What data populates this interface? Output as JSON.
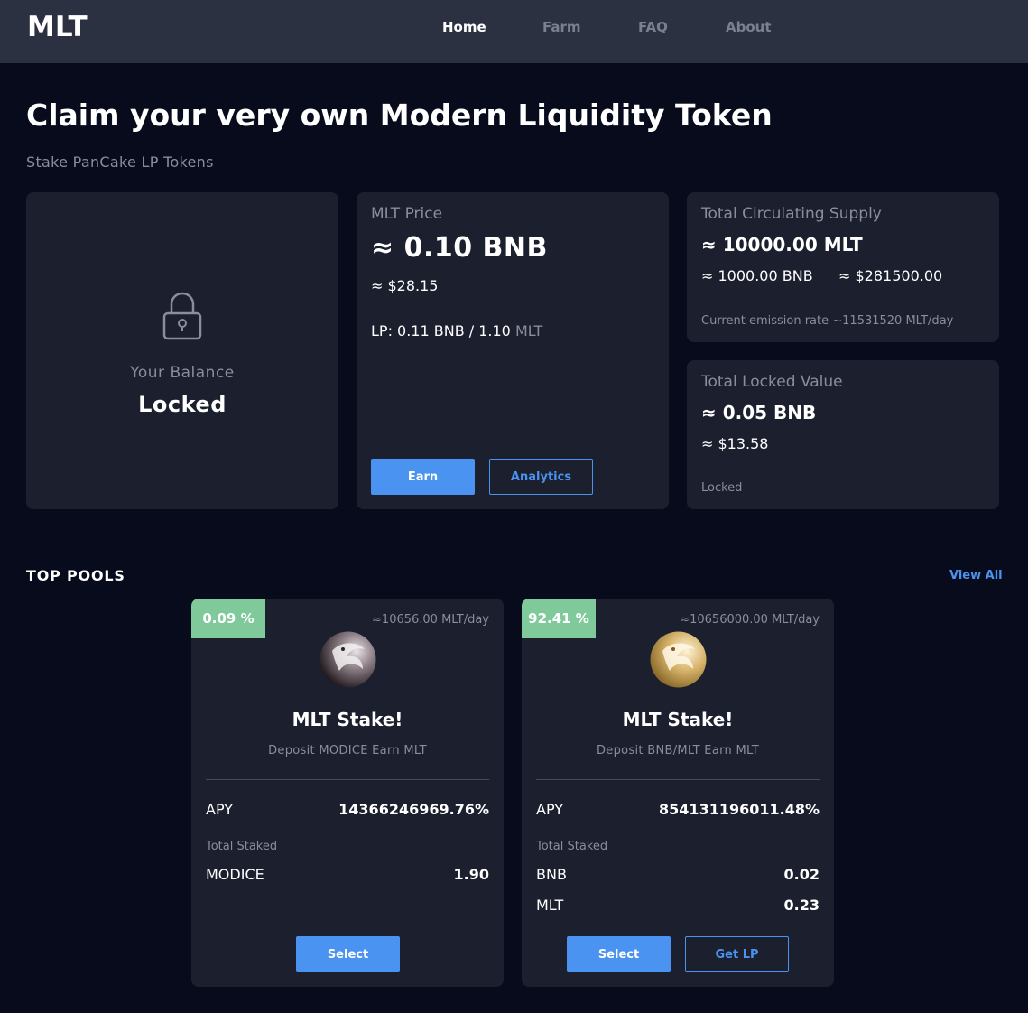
{
  "nav": {
    "logo": "MLT",
    "links": [
      "Home",
      "Farm",
      "FAQ",
      "About"
    ],
    "active": "Home"
  },
  "hero": {
    "title": "Claim your very own Modern Liquidity Token",
    "subtitle": "Stake PanCake LP Tokens"
  },
  "balance": {
    "label": "Your Balance",
    "value": "Locked"
  },
  "price": {
    "label": "MLT Price",
    "value": "≈ 0.10 BNB",
    "usd": "≈ $28.15",
    "lp_prefix": "LP: 0.11 BNB / 1.10",
    "lp_suffix": "MLT",
    "earn_label": "Earn",
    "analytics_label": "Analytics"
  },
  "supply": {
    "label": "Total Circulating Supply",
    "value": "≈ 10000.00 MLT",
    "bnb": "≈ 1000.00 BNB",
    "usd": "≈ $281500.00",
    "emission": "Current emission rate ~11531520 MLT/day"
  },
  "tvl": {
    "label": "Total Locked Value",
    "value": "≈ 0.05 BNB",
    "usd": "≈ $13.58",
    "status": "Locked"
  },
  "pools_section": {
    "title": "TOP POOLS",
    "view_all": "View All"
  },
  "pools": [
    {
      "badge": "0.09 %",
      "rate": "≈10656.00 MLT/day",
      "name": "MLT Stake!",
      "desc": "Deposit MODICE Earn MLT",
      "apy_label": "APY",
      "apy": "14366246969.76%",
      "staked_label": "Total Staked",
      "staked": [
        {
          "token": "MODICE",
          "amount": "1.90"
        }
      ],
      "select_label": "Select"
    },
    {
      "badge": "92.41 %",
      "rate": "≈10656000.00 MLT/day",
      "name": "MLT Stake!",
      "desc": "Deposit BNB/MLT Earn MLT",
      "apy_label": "APY",
      "apy": "854131196011.48%",
      "staked_label": "Total Staked",
      "staked": [
        {
          "token": "BNB",
          "amount": "0.02"
        },
        {
          "token": "MLT",
          "amount": "0.23"
        }
      ],
      "select_label": "Select",
      "getlp_label": "Get LP"
    }
  ],
  "colors": {
    "accent": "#4a93f0",
    "badge": "#7fc99a",
    "background": "#070b1c",
    "card": "#1b1f2e",
    "nav": "#2c3142"
  }
}
